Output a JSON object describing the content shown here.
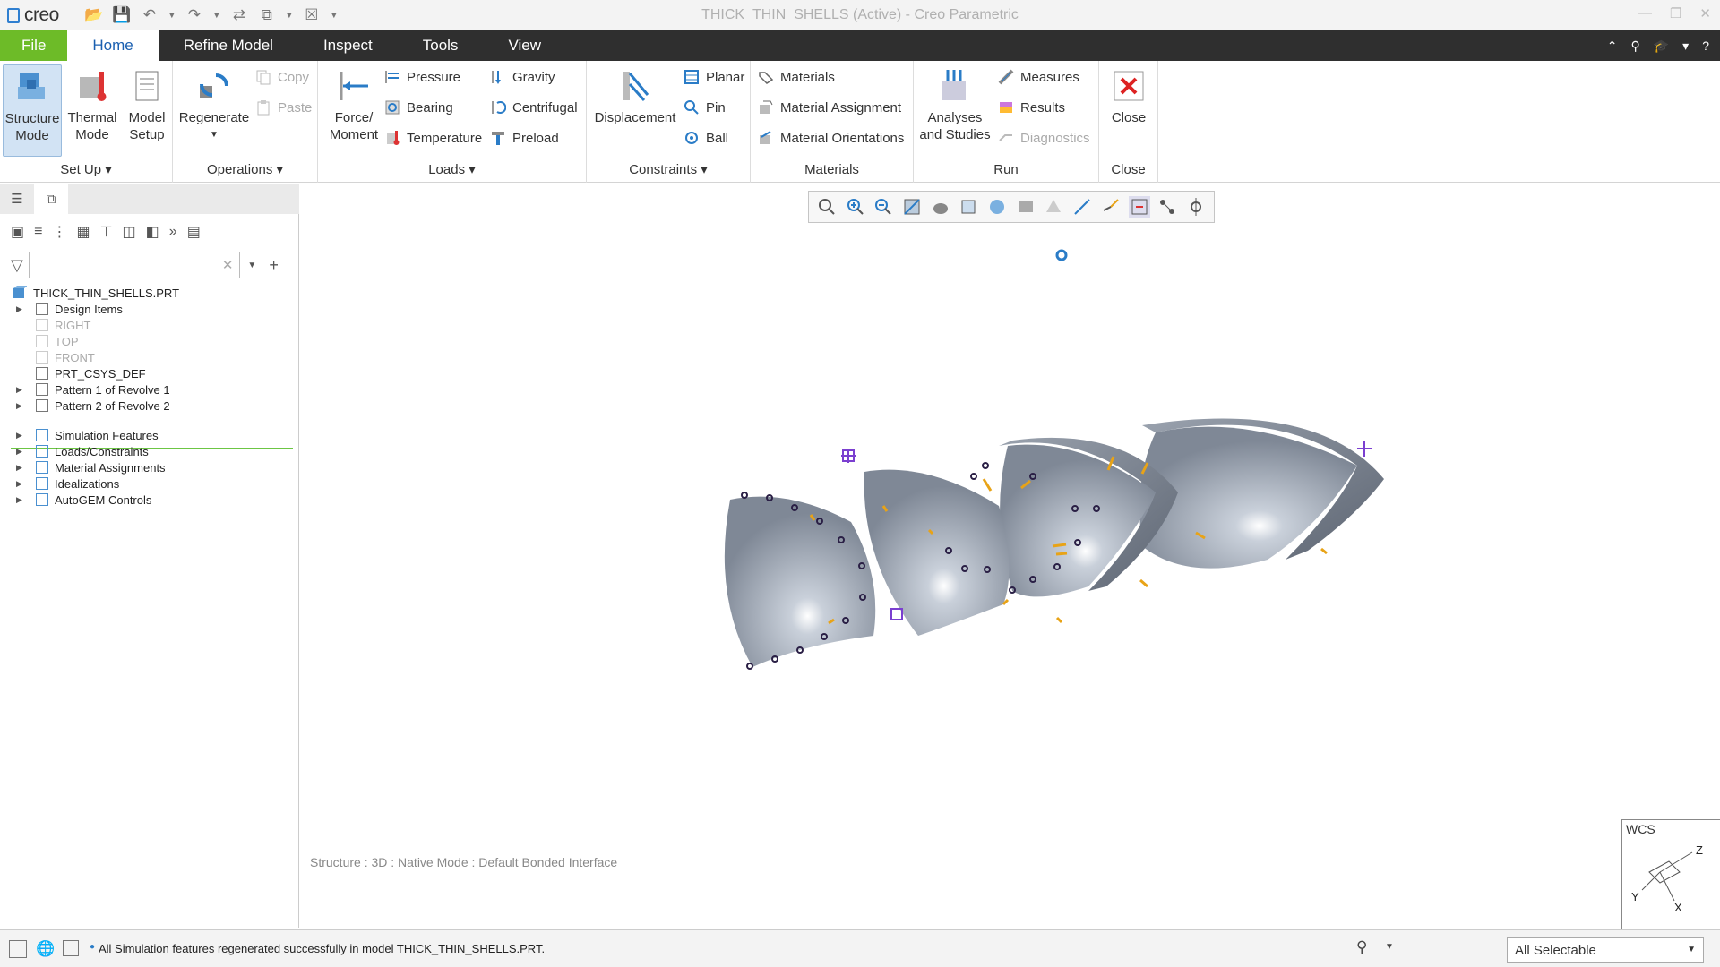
{
  "app": {
    "logo": "creo",
    "window_title": "THICK_THIN_SHELLS (Active) - Creo Parametric"
  },
  "tabs": [
    "File",
    "Home",
    "Refine Model",
    "Inspect",
    "Tools",
    "View"
  ],
  "ribbon": {
    "setup": {
      "structure_mode": "Structure\nMode",
      "thermal_mode": "Thermal\nMode",
      "model_setup": "Model\nSetup",
      "label": "Set Up"
    },
    "operations": {
      "regenerate": "Regenerate",
      "copy": "Copy",
      "paste": "Paste",
      "label": "Operations"
    },
    "loads": {
      "force_moment": "Force/\nMoment",
      "pressure": "Pressure",
      "bearing": "Bearing",
      "temperature": "Temperature",
      "gravity": "Gravity",
      "centrifugal": "Centrifugal",
      "preload": "Preload",
      "label": "Loads"
    },
    "constraints": {
      "displacement": "Displacement",
      "planar": "Planar",
      "pin": "Pin",
      "ball": "Ball",
      "label": "Constraints"
    },
    "materials": {
      "materials": "Materials",
      "material_assignment": "Material Assignment",
      "material_orientations": "Material Orientations",
      "label": "Materials"
    },
    "run": {
      "analyses": "Analyses\nand Studies",
      "measures": "Measures",
      "results": "Results",
      "diagnostics": "Diagnostics",
      "label": "Run"
    },
    "close": {
      "close": "Close",
      "label": "Close"
    }
  },
  "tree": {
    "search_placeholder": "",
    "root": "THICK_THIN_SHELLS.PRT",
    "items": [
      {
        "label": "Design Items",
        "expandable": true,
        "dim": false
      },
      {
        "label": "RIGHT",
        "expandable": false,
        "dim": true
      },
      {
        "label": "TOP",
        "expandable": false,
        "dim": true
      },
      {
        "label": "FRONT",
        "expandable": false,
        "dim": true
      },
      {
        "label": "PRT_CSYS_DEF",
        "expandable": false,
        "dim": false
      },
      {
        "label": "Pattern 1 of Revolve 1",
        "expandable": true,
        "dim": false
      },
      {
        "label": "Pattern 2 of Revolve 2",
        "expandable": true,
        "dim": false
      }
    ],
    "sim_items": [
      "Simulation Features",
      "Loads/Constraints",
      "Material Assignments",
      "Idealizations",
      "AutoGEM Controls"
    ]
  },
  "graphics": {
    "status_line": "Structure : 3D : Native Mode : Default Bonded Interface",
    "wcs_label": "WCS",
    "axis_z": "Z",
    "axis_x": "X",
    "axis_y": "Y"
  },
  "status": {
    "message": "All Simulation features regenerated successfully in model THICK_THIN_SHELLS.PRT.",
    "selection_filter": "All Selectable"
  },
  "colors": {
    "file_tab": "#6dbb28",
    "tab_bar": "#2f2f2f",
    "active_tab_text": "#1a5fb0",
    "load_arrow": "#e8a317",
    "constraint_marker": "#3a2a5a"
  }
}
